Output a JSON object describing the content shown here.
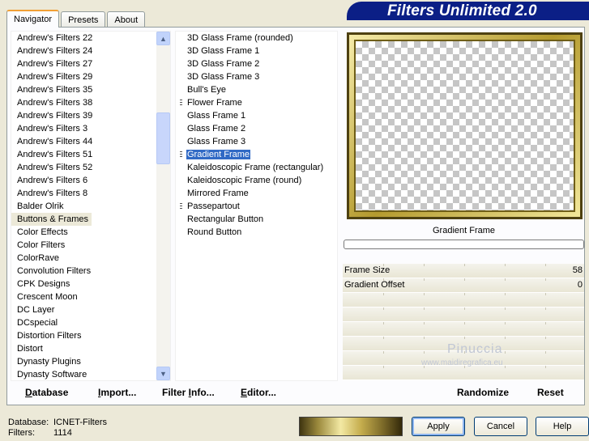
{
  "tabs": [
    "Navigator",
    "Presets",
    "About"
  ],
  "active_tab": "Navigator",
  "banner": "Filters Unlimited 2.0",
  "categories": [
    "Andrew's Filters 22",
    "Andrew's Filters 24",
    "Andrew's Filters 27",
    "Andrew's Filters 29",
    "Andrew's Filters 35",
    "Andrew's Filters 38",
    "Andrew's Filters 39",
    "Andrew's Filters 3",
    "Andrew's Filters 44",
    "Andrew's Filters 51",
    "Andrew's Filters 52",
    "Andrew's Filters 6",
    "Andrew's Filters 8",
    "Balder Olrik",
    "Buttons & Frames",
    "Color Effects",
    "Color Filters",
    "ColorRave",
    "Convolution Filters",
    "CPK Designs",
    "Crescent Moon",
    "DC Layer",
    "DCspecial",
    "Distortion Filters",
    "Distort",
    "Dynasty Plugins",
    "Dynasty Software"
  ],
  "selected_category": "Buttons & Frames",
  "filters": [
    {
      "label": "3D Glass Frame (rounded)",
      "mark": false
    },
    {
      "label": "3D Glass Frame 1",
      "mark": false
    },
    {
      "label": "3D Glass Frame 2",
      "mark": false
    },
    {
      "label": "3D Glass Frame 3",
      "mark": false
    },
    {
      "label": "Bull's Eye",
      "mark": false
    },
    {
      "label": "Flower Frame",
      "mark": true
    },
    {
      "label": "Glass Frame 1",
      "mark": false
    },
    {
      "label": "Glass Frame 2",
      "mark": false
    },
    {
      "label": "Glass Frame 3",
      "mark": false
    },
    {
      "label": "Gradient Frame",
      "mark": true
    },
    {
      "label": "Kaleidoscopic Frame (rectangular)",
      "mark": false
    },
    {
      "label": "Kaleidoscopic Frame (round)",
      "mark": false
    },
    {
      "label": "Mirrored Frame",
      "mark": false
    },
    {
      "label": "Passepartout",
      "mark": true
    },
    {
      "label": "Rectangular Button",
      "mark": false
    },
    {
      "label": "Round Button",
      "mark": false
    }
  ],
  "selected_filter": "Gradient Frame",
  "preview": {
    "filter_name": "Gradient Frame"
  },
  "params": [
    {
      "label": "Frame Size",
      "value": "58",
      "level": 58
    },
    {
      "label": "Gradient Offset",
      "value": "0",
      "level": 0
    },
    {
      "label": "",
      "value": ""
    },
    {
      "label": "",
      "value": ""
    },
    {
      "label": "",
      "value": ""
    },
    {
      "label": "",
      "value": ""
    },
    {
      "label": "",
      "value": ""
    },
    {
      "label": "",
      "value": ""
    }
  ],
  "watermark": {
    "name": "Pinuccia",
    "site": "www.maidiregrafica.eu"
  },
  "toolbar": {
    "database": {
      "u": "D",
      "rest": "atabase"
    },
    "import": {
      "u": "I",
      "rest": "mport..."
    },
    "filter_info": {
      "pre": "Filter ",
      "u": "I",
      "rest": "nfo..."
    },
    "editor": {
      "u": "E",
      "rest": "ditor..."
    },
    "randomize": "Randomize",
    "reset": "Reset"
  },
  "info": {
    "database_label": "Database:",
    "database_value": "ICNET-Filters",
    "filters_label": "Filters:",
    "filters_value": "1114"
  },
  "buttons": {
    "apply": "Apply",
    "cancel": "Cancel",
    "help": "Help"
  },
  "colors": {
    "banner": "#0b1f86",
    "selection": "#316ac5",
    "frame_gold": "#b49a2e"
  }
}
